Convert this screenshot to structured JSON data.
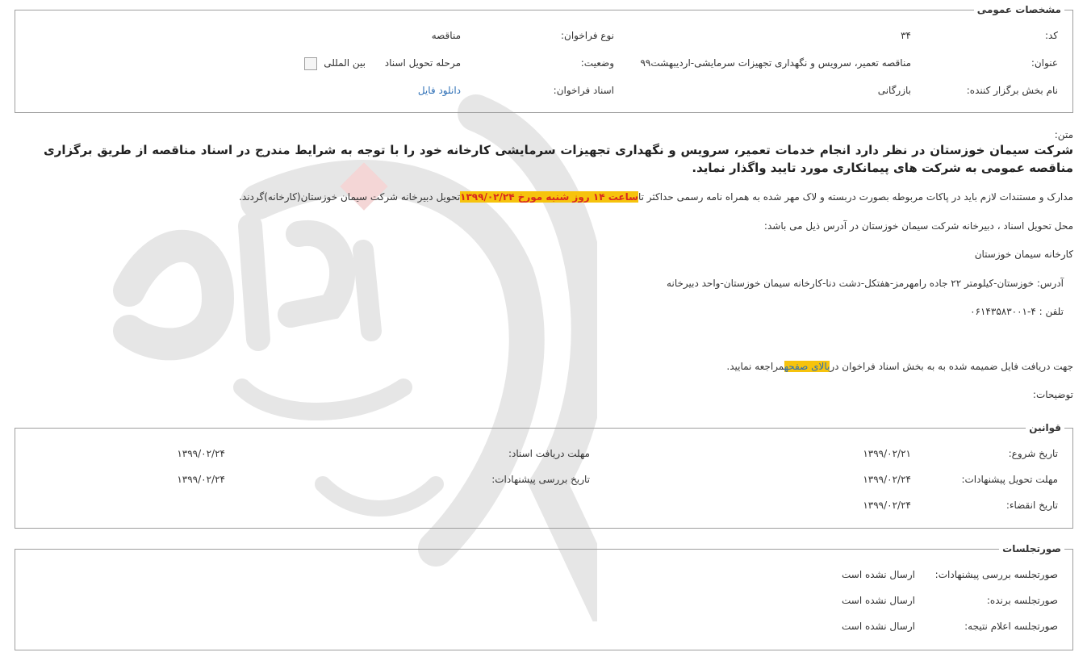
{
  "general": {
    "legend": "مشخصات عمومی",
    "code_label": "کد:",
    "code_value": "۳۴",
    "call_type_label": "نوع فراخوان:",
    "call_type_value": "مناقصه",
    "title_label": "عنوان:",
    "title_value": "مناقصه تعمیر، سرویس و نگهداری تجهیزات سرمایشی-اردیبهشت۹۹",
    "status_label": "وضعیت:",
    "status_value": "مرحله تحویل اسناد",
    "international_label": "بین المللی",
    "international_checked": false,
    "organizer_label": "نام بخش برگزار کننده:",
    "organizer_value": "بازرگانی",
    "documents_label": "اسناد فراخوان:",
    "documents_link": "دانلود فایل"
  },
  "content": {
    "text_label": "متن:",
    "headline": "شرکت سیمان خوزستان در نظر دارد انجام خدمات تعمیر، سرویس و نگهداری تجهیزات سرمایشی کارخانه خود را با توجه به شرایط مندرج در اسناد مناقصه از طریق برگزاری مناقصه عمومی به شرکت های پیمانکاری مورد تایید واگذار نماید.",
    "docs_line_part1": "مدارک و مستندات لازم باید در پاکات مربوطه بصورت دربسته و لاک مهر شده به همراه نامه رسمی حداکثر تا",
    "docs_line_highlight": "ساعت ۱۴ روز شنبه مورخ ۱۳۹۹/۰۲/۲۴",
    "docs_line_part2": "تحویل دبیرخانه شرکت سیمان خوزستان(کارخانه)گردند.",
    "delivery_place": "محل تحویل اسناد ، دبیرخانه شرکت سیمان خوزستان در آدرس ذیل می باشد:",
    "factory_name": "کارخانه سیمان خوزستان",
    "address": "آدرس: خوزستان-کیلومتر ۲۲ جاده رامهرمز-هفتکل-دشت دنا-کارخانه سیمان خوزستان-واحد دبیرخانه",
    "phone": "تلفن : ۴-۰۶۱۴۳۵۸۳۰۰۱",
    "download_part1": "جهت دریافت فایل ضمیمه شده به به بخش اسناد فراخوان در",
    "download_link": "بالای صفحه",
    "download_part2": "مراجعه نمایید.",
    "notes_label": "توضیحات:"
  },
  "rules": {
    "legend": "قوانین",
    "start_label": "تاریخ شروع:",
    "start_value": "۱۳۹۹/۰۲/۲۱",
    "doc_deadline_label": "مهلت دریافت اسناد:",
    "doc_deadline_value": "۱۳۹۹/۰۲/۲۴",
    "offer_deadline_label": "مهلت تحویل پیشنهادات:",
    "offer_deadline_value": "۱۳۹۹/۰۲/۲۴",
    "review_label": "تاریخ بررسی پیشنهادات:",
    "review_value": "۱۳۹۹/۰۲/۲۴",
    "expiry_label": "تاریخ انقضاء:",
    "expiry_value": "۱۳۹۹/۰۲/۲۴"
  },
  "minutes": {
    "legend": "صورتجلسات",
    "review_label": "صورتجلسه بررسی پیشنهادات:",
    "review_value": "ارسال نشده است",
    "winner_label": "صورتجلسه برنده:",
    "winner_value": "ارسال نشده است",
    "result_label": "صورتجلسه اعلام نتیجه:",
    "result_value": "ارسال نشده است"
  }
}
